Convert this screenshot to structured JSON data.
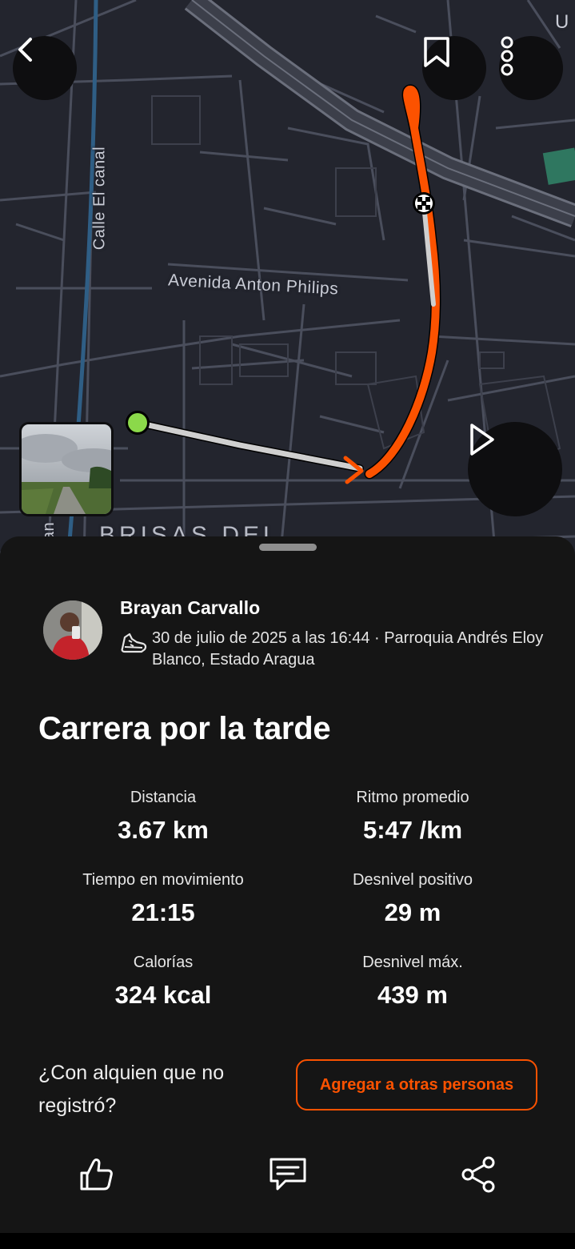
{
  "map": {
    "street_labels": [
      "Calle El canal",
      "Avenida Anton Philips",
      "BRISAS DEL",
      "an",
      "U"
    ],
    "route_color": "#fc5200",
    "start_color": "#8bd94a"
  },
  "header": {
    "back_icon": "chevron-left-icon",
    "bookmark_icon": "bookmark-icon",
    "more_icon": "more-vertical-icon"
  },
  "play_icon": "play-icon",
  "activity": {
    "athlete": "Brayan Carvallo",
    "sport_icon": "running-shoe-icon",
    "datetime_location": "30 de julio de 2025 a las 16:44 · Parroquia Andrés Eloy Blanco, Estado Aragua",
    "title": "Carrera por la tarde",
    "stats": [
      {
        "label": "Distancia",
        "value": "3.67 km"
      },
      {
        "label": "Ritmo promedio",
        "value": "5:47 /km"
      },
      {
        "label": "Tiempo en movimiento",
        "value": "21:15"
      },
      {
        "label": "Desnivel positivo",
        "value": "29 m"
      },
      {
        "label": "Calorías",
        "value": "324 kcal"
      },
      {
        "label": "Desnivel máx.",
        "value": "439 m"
      }
    ]
  },
  "tag_prompt": {
    "question": "¿Con alquien que no registró?",
    "button": "Agregar a otras personas"
  },
  "actions": {
    "kudos_icon": "thumbs-up-icon",
    "comment_icon": "comment-icon",
    "share_icon": "share-icon"
  },
  "colors": {
    "accent": "#fc5200",
    "sheet_bg": "#151515",
    "map_bg": "#23252e"
  }
}
